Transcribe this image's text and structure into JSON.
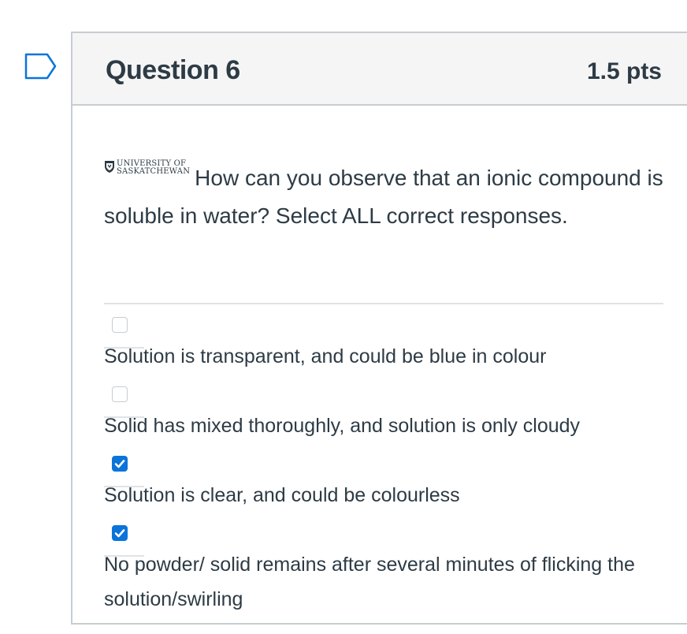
{
  "question": {
    "title": "Question 6",
    "points": "1.5 pts",
    "logo_line1": "UNIVERSITY OF",
    "logo_line2": "SASKATCHEWAN",
    "text": "How can you observe that an ionic compound is soluble in water? Select ALL correct responses."
  },
  "answers": [
    {
      "label": "Solution is transparent, and could be blue in colour",
      "checked": false
    },
    {
      "label": "Solid has mixed thoroughly, and solution is only cloudy",
      "checked": false
    },
    {
      "label": "Solution is clear, and could be colourless",
      "checked": true
    },
    {
      "label": "No powder/ solid remains after several minutes of flicking the solution/swirling",
      "checked": true
    }
  ],
  "colors": {
    "accent": "#0b74d9",
    "text": "#2d3b45",
    "header_bg": "#f5f5f5",
    "border": "#c7cdd1"
  },
  "icons": {
    "flag": "flag-question-icon",
    "logo": "university-shield-icon",
    "check": "checkmark-icon"
  }
}
